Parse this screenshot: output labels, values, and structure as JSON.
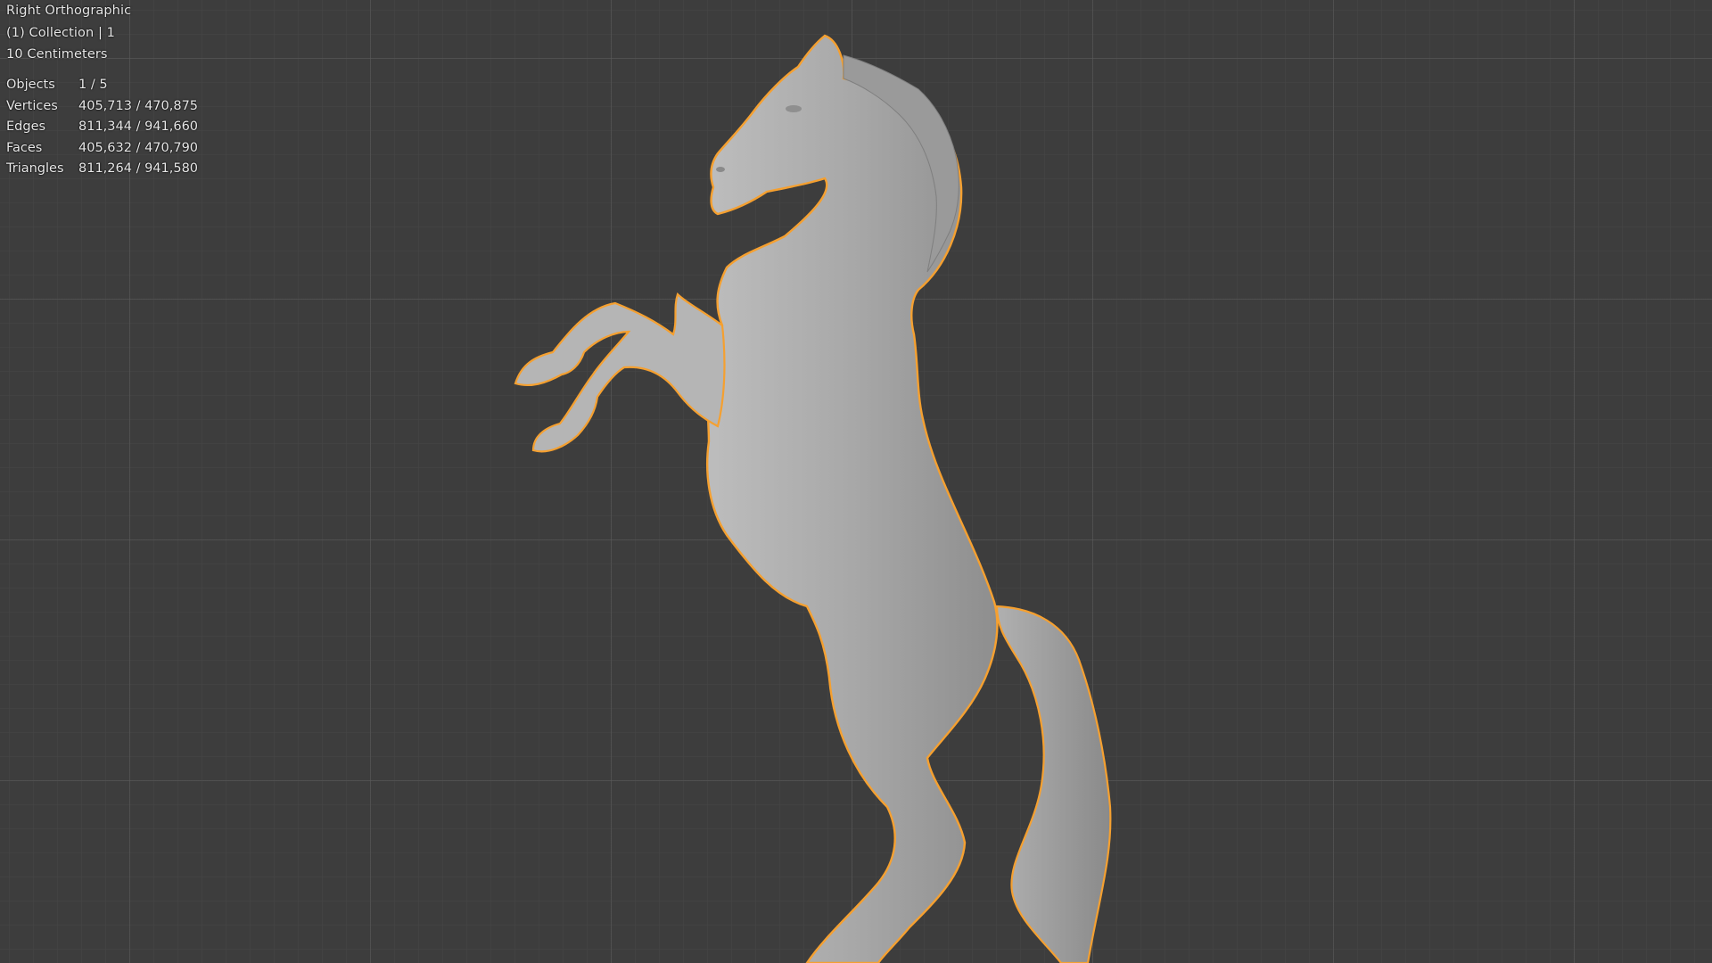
{
  "viewport": {
    "view_name": "Right Orthographic",
    "collection_info": "(1) Collection | 1",
    "scale_label": "10 Centimeters",
    "background_color": "#3d3d3d",
    "selection_outline_color": "#f5a030",
    "model_color": "#a9a9a9"
  },
  "stats": {
    "objects": {
      "label": "Objects",
      "value": "1 / 5"
    },
    "vertices": {
      "label": "Vertices",
      "value": "405,713 / 470,875"
    },
    "edges": {
      "label": "Edges",
      "value": "811,344 / 941,660"
    },
    "faces": {
      "label": "Faces",
      "value": "405,632 / 470,790"
    },
    "triangles": {
      "label": "Triangles",
      "value": "811,264 / 941,580"
    }
  },
  "model": {
    "icon": "rearing-horse-mesh",
    "selected": true
  }
}
